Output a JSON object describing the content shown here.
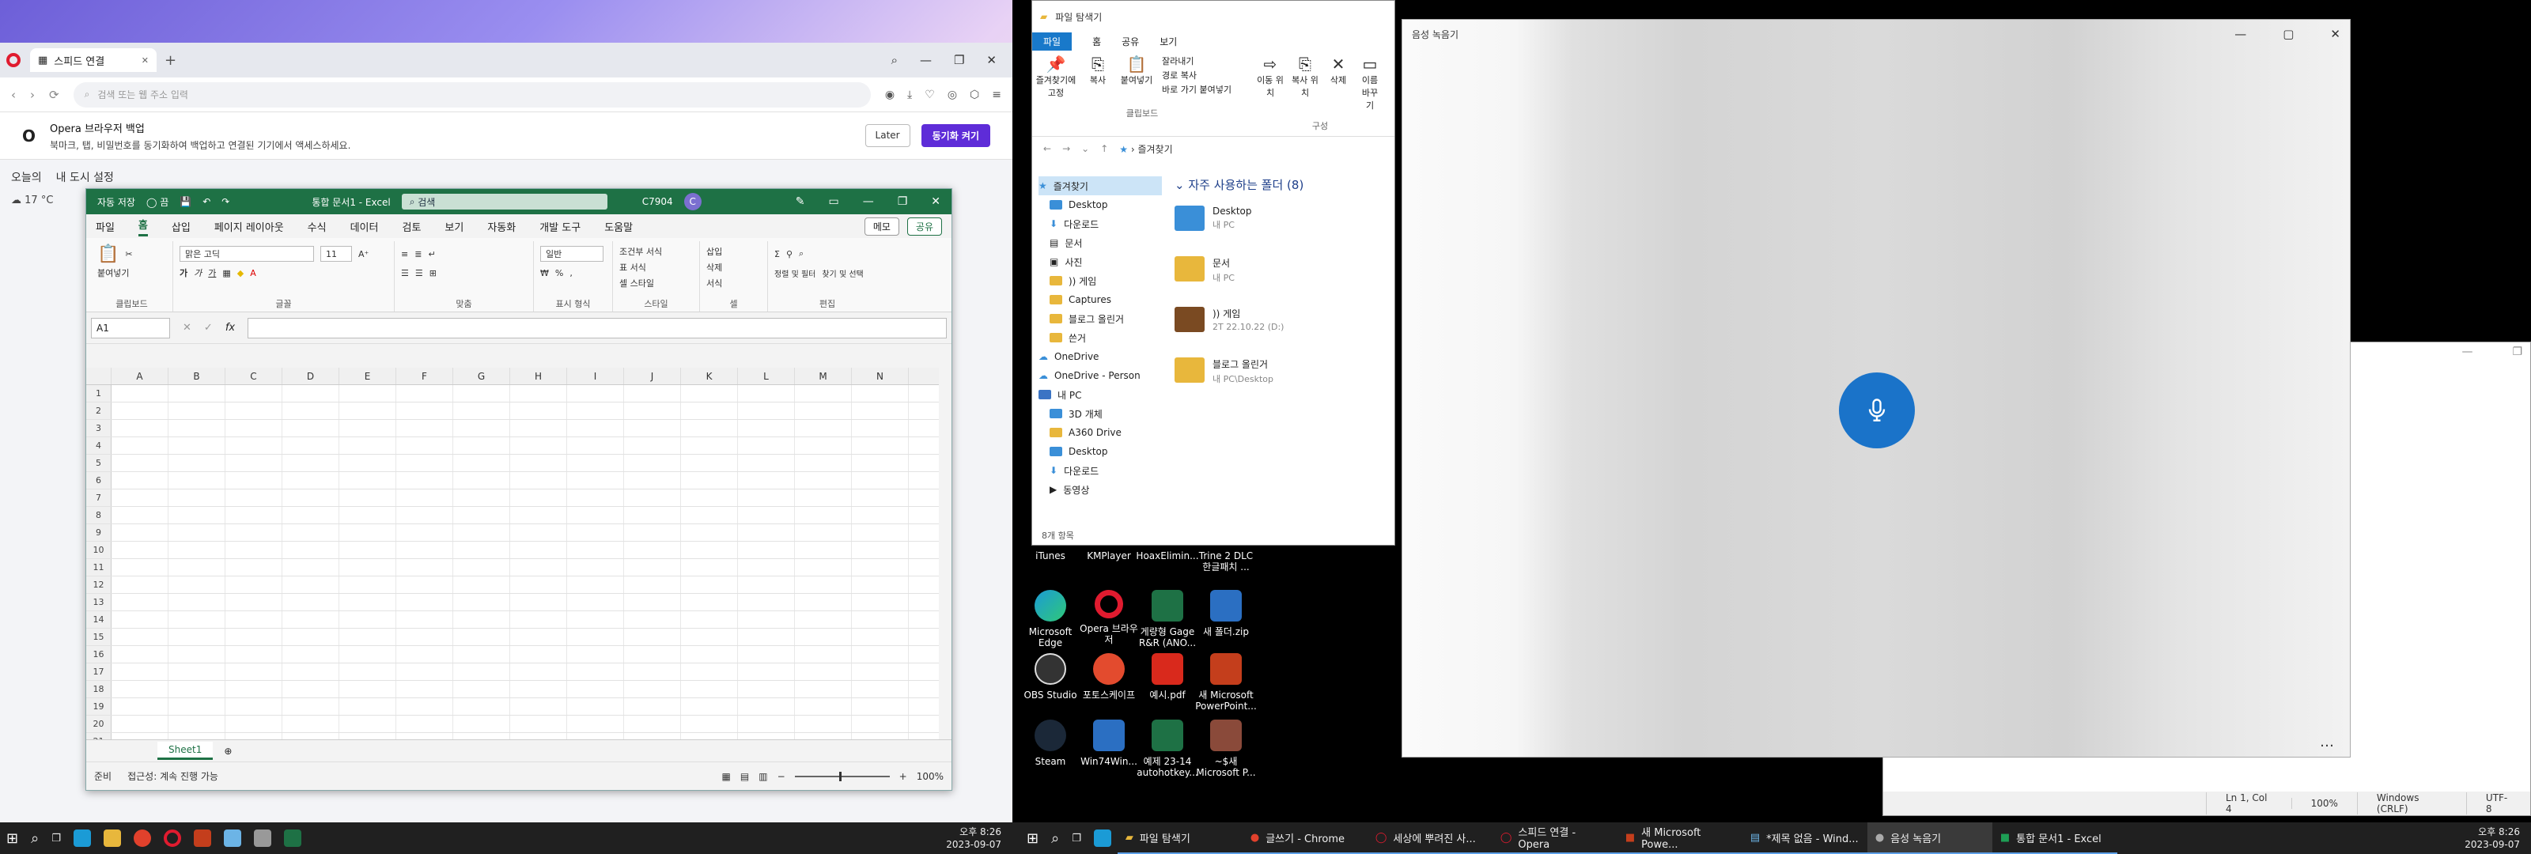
{
  "left": {
    "opera": {
      "tab_title": "스피드 연결",
      "address_placeholder": "검색 또는 웹 주소 입력",
      "banner_title": "Opera 브라우저 백업",
      "banner_text": "북마크, 탭, 비밀번호를 동기화하여 백업하고 연결된 기기에서 액세스하세요.",
      "later_label": "Later",
      "sync_label": "동기화 켜기",
      "speed_tabs": [
        "오늘의",
        "내 도시 설정"
      ],
      "weather": "17 °C"
    },
    "excel": {
      "autosave": "자동 저장",
      "title": "통합 문서1 - Excel",
      "search": "검색",
      "user_id": "C7904",
      "avatar": "C",
      "menu": [
        "파일",
        "홈",
        "삽입",
        "페이지 레이아웃",
        "수식",
        "데이터",
        "검토",
        "보기",
        "자동화",
        "개발 도구",
        "도움말"
      ],
      "memo_label": "메모",
      "share_label": "공유",
      "ribbon": {
        "clipboard": "클립보드",
        "paste": "붙여넣기",
        "font_name": "맑은 고딕",
        "font_size": "11",
        "font": "글꼴",
        "align": "맞춤",
        "number_format": "일반",
        "number": "표시 형식",
        "cond_format": "조건부 서식",
        "table_format": "표 서식",
        "cell_style": "셀 스타일",
        "style": "스타일",
        "insert": "삽입",
        "delete": "삭제",
        "format": "서식",
        "cells": "셀",
        "sort_filter": "정렬 및 필터",
        "find_select": "찾기 및 선택",
        "editing": "편집"
      },
      "name_box": "A1",
      "fx": "fx",
      "columns": [
        "A",
        "B",
        "C",
        "D",
        "E",
        "F",
        "G",
        "H",
        "I",
        "J",
        "K",
        "L",
        "M",
        "N"
      ],
      "rows": [
        "1",
        "2",
        "3",
        "4",
        "5",
        "6",
        "7",
        "8",
        "9",
        "10",
        "11",
        "12",
        "13",
        "14",
        "15",
        "16",
        "17",
        "18",
        "19",
        "20",
        "21"
      ],
      "sheet": "Sheet1",
      "status_ready": "준비",
      "status_access": "접근성: 계속 진행 가능",
      "zoom": "100%"
    },
    "taskbar_time": "오후 8:26",
    "taskbar_date": "2023-09-07"
  },
  "right": {
    "explorer": {
      "title": "파일 탐색기",
      "tabs": [
        "파일",
        "홈",
        "공유",
        "보기"
      ],
      "ribbon": {
        "pin": "즐겨찾기에 고정",
        "copy": "복사",
        "paste": "붙여넣기",
        "cut": "잘라내기",
        "copy_path": "경로 복사",
        "paste_shortcut": "바로 가기 붙여넣기",
        "clipboard": "클립보드",
        "move_to": "이동 위치",
        "copy_to": "복사 위치",
        "delete": "삭제",
        "rename": "이름 바꾸기",
        "organize": "구성"
      },
      "breadcrumb": "즐겨찾기",
      "sidebar": [
        "즐겨찾기",
        "Desktop",
        "다운로드",
        "문서",
        "사진",
        ")) 게임",
        "Captures",
        "블로그 올린거",
        "쓴거",
        "OneDrive",
        "OneDrive - Person",
        "내 PC",
        "3D 개체",
        "A360 Drive",
        "Desktop",
        "다운로드",
        "동영상"
      ],
      "section": "자주 사용하는 폴더 (8)",
      "folders": [
        {
          "name": "Desktop",
          "sub": "내 PC"
        },
        {
          "name": "문서",
          "sub": "내 PC"
        },
        {
          "name": ")) 게임",
          "sub": "2T 22.10.22 (D:)"
        },
        {
          "name": "블로그 올린거",
          "sub": "내 PC\\Desktop"
        }
      ],
      "status": "8개 항목"
    },
    "desktop_icons": [
      {
        "label": "iTunes"
      },
      {
        "label": "KMPlayer"
      },
      {
        "label": "HoaxElimin..."
      },
      {
        "label": "Trine 2 DLC 한글패치 ..."
      },
      {
        "label": "Microsoft Edge"
      },
      {
        "label": "Opera 브라우저"
      },
      {
        "label": "게량형 Gage R&R (ANO..."
      },
      {
        "label": "새 폴더.zip"
      },
      {
        "label": "OBS Studio"
      },
      {
        "label": "포토스케이프"
      },
      {
        "label": "예시.pdf"
      },
      {
        "label": "새 Microsoft PowerPoint..."
      },
      {
        "label": "Steam"
      },
      {
        "label": "Win74Win..."
      },
      {
        "label": "예제 23-14 autohotkey..."
      },
      {
        "label": "~$새 Microsoft P..."
      }
    ],
    "recorder_title": "음성 녹음기",
    "notepad_status": [
      "Ln 1, Col 4",
      "100%",
      "Windows (CRLF)",
      "UTF-8"
    ],
    "taskbar_apps": [
      "파일 탐색기",
      "글쓰기 - Chrome",
      "세상에 뿌려진 사...",
      "스피드 연결 - Opera",
      "새 Microsoft Powe...",
      "*제목 없음 - Wind...",
      "음성 녹음기",
      "통합 문서1 - Excel"
    ],
    "taskbar_time": "오후 8:26",
    "taskbar_date": "2023-09-07"
  }
}
